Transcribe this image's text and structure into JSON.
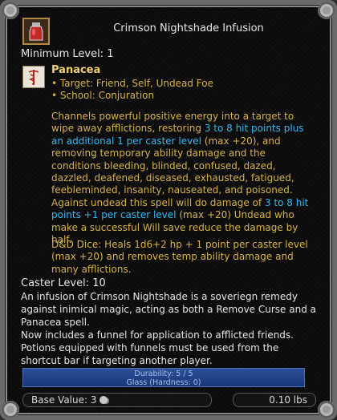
{
  "header": {
    "title": "Crimson Nightshade Infusion",
    "icon": "potion-icon"
  },
  "min_level": "Minimum Level: 1",
  "spell": {
    "icon": "caduceus-icon",
    "name": "Panacea",
    "target": "• Target: Friend, Self, Undead Foe",
    "school": "• School: Conjuration"
  },
  "description": {
    "p1_a": "Channels powerful positive energy into a target to wipe away afflictions, restoring ",
    "p1_hl1": "3 to 8 hit points plus an additional 1 per caster level",
    "p1_b": " (max +20), and removing temporary ability damage and the conditions bleeding, blinded, confused, dazed, dazzled, deafened, diseased, exhausted, fatigued, feebleminded, insanity, nauseated, and poisoned. Against undead this spell will do damage of ",
    "p1_hl2": "3 to 8 hit points +1 per caster level",
    "p1_c": " (max +20) Undead who make a successful Will save reduce the damage by half.",
    "dice": "D&D Dice: Heals 1d6+2 hp + 1 point per caster level (max +20) and removes temp ability damage and many afflictions."
  },
  "caster_level": "Caster Level: 10",
  "item_description": "An infusion of Crimson Nightshade is a soveriegn remedy against inimical magic, acting as both a Remove Curse and a Panacea spell.\nNow includes a funnel for application to afflicted friends. Potions equipped with funnels must be used from the shortcut bar if targeting another player.",
  "durability": {
    "line1": "Durability: 5 / 5",
    "line2": "Glass (Hardness: 0)",
    "fraction": 1.0
  },
  "footer": {
    "base_value": "Base Value: 3",
    "coin_icon": "silver-coin-icon",
    "weight": "0.10 lbs"
  },
  "colors": {
    "title": "#e6e6e6",
    "spell_text": "#d7b34a",
    "highlight": "#33b8f2",
    "durability_bar": "#1f3f88"
  }
}
